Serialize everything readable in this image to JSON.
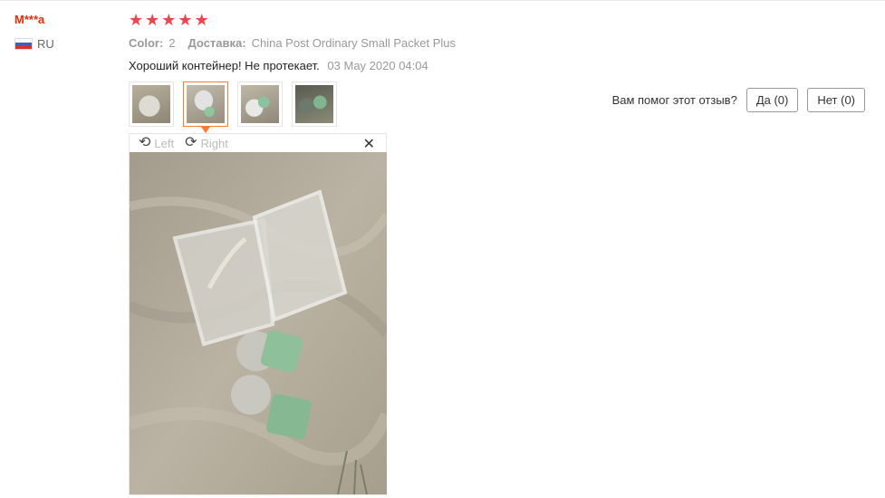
{
  "user": {
    "name": "M***a",
    "country": "RU"
  },
  "rating": {
    "stars": 5,
    "symbol": "★"
  },
  "info": {
    "color_label": "Color:",
    "color_value": "2",
    "delivery_label": "Доставка:",
    "delivery_value": "China Post Ordinary Small Packet Plus"
  },
  "review": {
    "text": "Хороший контейнер! Не протекает.",
    "date": "03 May 2020 04:04"
  },
  "viewer": {
    "left_label": "Left",
    "right_label": "Right",
    "close_symbol": "✕"
  },
  "helpful": {
    "question": "Вам помог этот отзыв?",
    "yes_label": "Да (0)",
    "no_label": "Нет (0)"
  },
  "colors": {
    "accent": "#ff7b2e",
    "star": "#f1434a",
    "username": "#e62e04"
  }
}
